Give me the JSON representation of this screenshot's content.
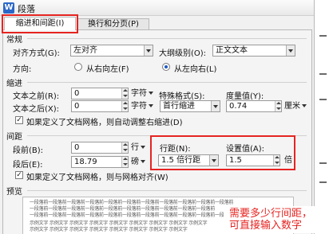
{
  "window": {
    "title": "段落",
    "app_icon_letter": "W"
  },
  "tabs": [
    {
      "label": "缩进和间距(I)",
      "active": true
    },
    {
      "label": "换行和分页(P)",
      "active": false
    }
  ],
  "general": {
    "section_label": "常规",
    "alignment_label": "对齐方式(G):",
    "alignment_value": "左对齐",
    "outline_label": "大纲级别(O):",
    "outline_value": "正文文本",
    "direction_label": "方向:",
    "rtl_label": "从右向左(F)",
    "ltr_label": "从左向右(L)",
    "direction_selected": "ltr"
  },
  "indent": {
    "section_label": "缩进",
    "before_label": "文本之前(R):",
    "before_value": "0",
    "before_unit": "字符",
    "after_label": "文本之后(X):",
    "after_value": "0",
    "after_unit": "字符",
    "special_label": "特殊格式(S):",
    "special_value": "首行缩进",
    "measure_label": "度量值(Y):",
    "measure_value": "0.74",
    "measure_unit": "厘米",
    "grid_check_label": "如果定义了文档网格，则自动调整右缩进(D)",
    "grid_checked": true
  },
  "spacing": {
    "section_label": "间距",
    "before_label": "段前(B):",
    "before_value": "0",
    "before_unit": "行",
    "after_label": "段后(E):",
    "after_value": "18.79",
    "after_unit": "磅",
    "line_label": "行距(N):",
    "line_value": "1.5 倍行距",
    "set_label": "设置值(A):",
    "set_value": "1.5",
    "set_unit": "倍",
    "grid_check_label": "如果定义了文档网格，则与网格对齐(W)",
    "grid_checked": true
  },
  "preview": {
    "section_label": "预览",
    "lines": [
      "一段落前一段落前一段落前一段落前一段落前一段落前一段落前一段落前一段落前一段落前一段落前",
      "一段落前一段落前一段落前一段落前一段落前一段落前一段落前一段落前一段落前一段落前",
      "一段落前一段落前一段落前一段落前一段落前一段落前一段落前一段落前一段落前一段落前一段落前",
      "示例文字 示例文字 示例文字 示例文字 示例文字 示例文字 示例文字 示例文字 示例文字",
      "示例文字 示例文字 示例文字 示例文字 示例文字 示例文字 示例文字 示例文字"
    ]
  },
  "annotation": {
    "line1": "需要多少行间距，",
    "line2": "可直接输入数字"
  },
  "colors": {
    "highlight": "#e52421",
    "accent": "#2b67c8"
  }
}
